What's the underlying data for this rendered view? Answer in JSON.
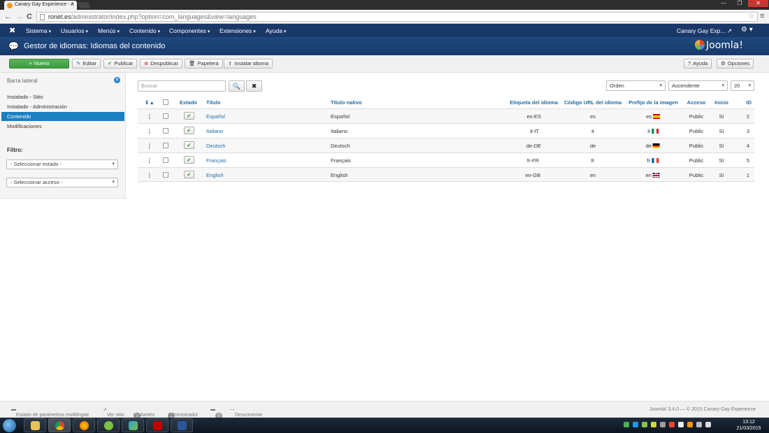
{
  "browser": {
    "tab_title": "Canary Gay Experience - A",
    "tab_close": "×",
    "url_host": "ronet.es",
    "url_path": "/administrator/index.php?option=com_languages&view=languages",
    "back": "←",
    "forward": "→",
    "reload": "C",
    "star": "☆",
    "menu": "≡",
    "window_min": "—",
    "window_max": "❐",
    "window_close": "✕"
  },
  "navbar": {
    "logo": "✖",
    "items": [
      "Sistema",
      "Usuarios",
      "Menús",
      "Contenido",
      "Componentes",
      "Extensiones",
      "Ayuda"
    ],
    "site_name": "Canary Gay Exp...",
    "site_link_icon": "↗",
    "gear": "⚙ ▾"
  },
  "title": {
    "icon": "💬",
    "text": "Gestor de idiomas: Idiomas del contenido",
    "brand": "Joomla!"
  },
  "toolbar": {
    "new": {
      "icon": "+",
      "label": "Nuevo"
    },
    "buttons": [
      {
        "icon": "✎",
        "label": "Editar"
      },
      {
        "icon": "✔",
        "label": "Publicar"
      },
      {
        "icon": "⊗",
        "label": "Despublicar"
      },
      {
        "icon": "🗑",
        "label": "Papelera"
      },
      {
        "icon": "⇪",
        "label": "Instalar idioma"
      }
    ],
    "help": {
      "icon": "?",
      "label": "Ayuda"
    },
    "options": {
      "icon": "⚙",
      "label": "Opciones"
    }
  },
  "sidebar": {
    "heading": "Barra lateral",
    "hide_icon": "✕",
    "links": [
      "Instalado - Sitio",
      "Instalado - Administración",
      "Contenido",
      "Modificaciones"
    ],
    "active_index": 2,
    "filter_label": "Filtro:",
    "select_state": "- Seleccionar estado -",
    "select_access": "- Seleccionar acceso -"
  },
  "filters": {
    "search_placeholder": "Buscar",
    "search_icon": "🔍",
    "clear_icon": "✖",
    "order_by": "Orden",
    "direction": "Ascendente",
    "limit": "20"
  },
  "table": {
    "headers": {
      "ordering": "⇕ ▴",
      "status": "Estado",
      "title": "Título",
      "native": "Título nativo",
      "tag": "Etiqueta del idioma",
      "url_code": "Código URL del idioma",
      "image": "Prefijo de la imagen",
      "access": "Acceso",
      "home": "Inicio",
      "id": "ID"
    },
    "drag_handle": "⋮",
    "status_check": "✔",
    "rows": [
      {
        "title": "Español",
        "native": "Español",
        "tag": "es-ES",
        "url_code": "es",
        "image": "es",
        "flag": "es",
        "access": "Public",
        "home": "Sí",
        "id": "2"
      },
      {
        "title": "Italiano",
        "native": "Italiano",
        "tag": "it-IT",
        "url_code": "it",
        "image": "it",
        "flag": "it",
        "access": "Public",
        "home": "Sí",
        "id": "3"
      },
      {
        "title": "Deutsch",
        "native": "Deutsch",
        "tag": "de-DE",
        "url_code": "de",
        "image": "de",
        "flag": "de",
        "access": "Public",
        "home": "Sí",
        "id": "4"
      },
      {
        "title": "Français",
        "native": "Français",
        "tag": "fr-FR",
        "url_code": "fr",
        "image": "fr",
        "flag": "fr",
        "access": "Public",
        "home": "Sí",
        "id": "5"
      },
      {
        "title": "English",
        "native": "English",
        "tag": "en-GB",
        "url_code": "en",
        "image": "en",
        "flag": "gb",
        "access": "Public",
        "home": "Sí",
        "id": "1"
      }
    ]
  },
  "footer": {
    "multilang": "Estado de parámetros multilingüe",
    "view_site": "Ver sitio",
    "visitors_count": "0",
    "visitors": "Visitantes",
    "admin_count": "1",
    "admin": "Administrador",
    "msg_count": "0",
    "logout": "Desconectar",
    "copyright": "Joomla! 3.4.0 — © 2015 Canary Gay Experience"
  },
  "taskbar": {
    "time": "13:12",
    "date": "21/03/2015",
    "apps": [
      "explorer",
      "chrome",
      "firefox",
      "utorrent",
      "transfer",
      "filezilla",
      "word"
    ]
  },
  "colors": {
    "navbar": "#1a3867",
    "accent": "#1c7fc2",
    "success": "#3d9a3d"
  }
}
